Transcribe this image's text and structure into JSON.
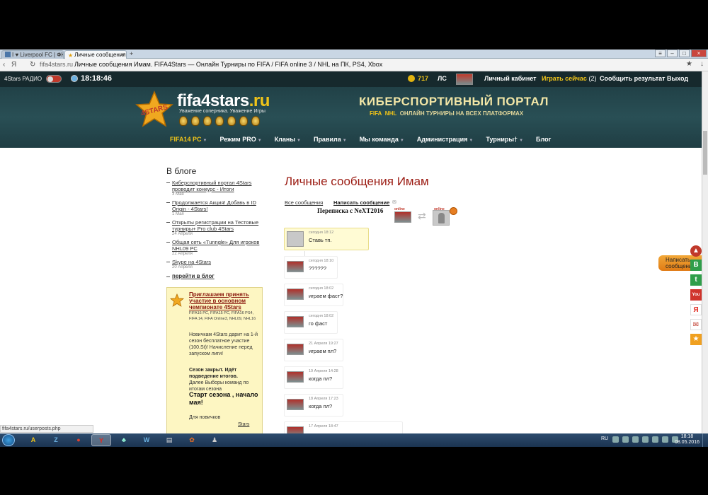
{
  "browser": {
    "tabs": [
      {
        "label": "I ♥ Liverpool FC | ФК"
      },
      {
        "label": "Личные сообщения И"
      }
    ],
    "new_tab": "+",
    "url": "fifa4stars.ru",
    "page_title": "Личные сообщения Имам. FIFA4Stars — Онлайн Турниры по FIFA / FIFA online 3 / NHL на ПК, PS4, Xbox",
    "status_url": "fifa4stars.ru/userposts.php"
  },
  "topbar": {
    "radio": "4Stars РАДИО",
    "clock": "18:18:46",
    "coins": "717",
    "ls": "ЛС",
    "cabinet": "Личный кабинет",
    "play": "Играть сейчас",
    "play_count": "(2)",
    "report": "Сообщить результат",
    "logout": "Выход"
  },
  "header": {
    "logo_main": "fifa4stars",
    "logo_ru": ".ru",
    "logo_star_text": "4STARS",
    "slogan": "Уважение соперника.  Уважение Игры",
    "portal_title": "КИБЕРСПОРТИВНЫЙ ПОРТАЛ",
    "portal_fifa": "FIFA",
    "portal_nhl": "NHL",
    "portal_rest": "ОНЛАЙН ТУРНИРЫ НА ВСЕХ ПЛАТФОРМАХ"
  },
  "nav": [
    {
      "label": "FIFA14 PC",
      "caret": "▼"
    },
    {
      "label": "Режим PRO",
      "caret": "▼"
    },
    {
      "label": "Кланы",
      "caret": "▼"
    },
    {
      "label": "Правила",
      "caret": "▼"
    },
    {
      "label": "Мы команда",
      "caret": "▼"
    },
    {
      "label": "Администрация",
      "caret": "▼"
    },
    {
      "label": "Турниры†",
      "caret": "▼"
    },
    {
      "label": "Блог",
      "caret": ""
    }
  ],
  "blog": {
    "title": "В блоге",
    "items": [
      {
        "title": "Киберспортивный портал 4Stars проводит конкурс - Итоги",
        "date": "3 Мая"
      },
      {
        "title": "Продолжается Акция! Добавь в ID Origin - 4Stars!",
        "date": "1 Мая"
      },
      {
        "title": "Открыты регистрации на Тестовые турниры+ Pro club 4Stars",
        "date": "24 Апреля"
      },
      {
        "title": "Общая сеть «Tunngle» Для игроков NHL09 PC",
        "date": "22 Апреля"
      },
      {
        "title": "Skype на 4Stars",
        "date": "20 Апреля"
      }
    ],
    "more": "перейти в блог"
  },
  "champ": {
    "title": "Приглашаем принять участие в основном чемпионате 4Stars",
    "platforms": "FIFA16 PC, FIFA15 PC, FIFA16 PS4, FIFA 14, FIFA Online3, NHL09, NHL16",
    "gift": "Новичкам 4Stars дарит на 1-й сезон бесплатное участие (100.St)! Начисление перед запуском лиги!",
    "closed": "Сезон закрыт. Идёт подведение итогов.",
    "draft": "Далее Выборы команд по итогам сезона",
    "start": "Старт сезона , начало мая!",
    "newbies": "Для новичков",
    "stars_link": "Stars"
  },
  "messages_page": {
    "heading": "Личные сообщения Имам",
    "all_link": "Все сообщения",
    "write_link": "Написать сообщение",
    "write_icon": "✉",
    "conversation": "Переписка с NeXT2016",
    "online": "online",
    "messages": [
      {
        "time": "сегодня 18:12",
        "text": "Ставь тп."
      },
      {
        "time": "сегодня 18:10",
        "text": "??????"
      },
      {
        "time": "сегодня 18:02",
        "text": "играем фаст?"
      },
      {
        "time": "сегодня 18:02",
        "text": "го фаст"
      },
      {
        "time": "21 Апреля 19:27",
        "text": "играем пл?"
      },
      {
        "time": "19 Апреля 14:28",
        "text": "когда пл?"
      },
      {
        "time": "18 Апреля 17:23",
        "text": "когда пл?"
      },
      {
        "time": "17 Апреля 18:47",
        "text": ""
      }
    ]
  },
  "side_widget": {
    "write": "Написать сообщение"
  },
  "taskbar": {
    "lang": "RU",
    "time": "18:18",
    "date": "08.05.2016"
  }
}
